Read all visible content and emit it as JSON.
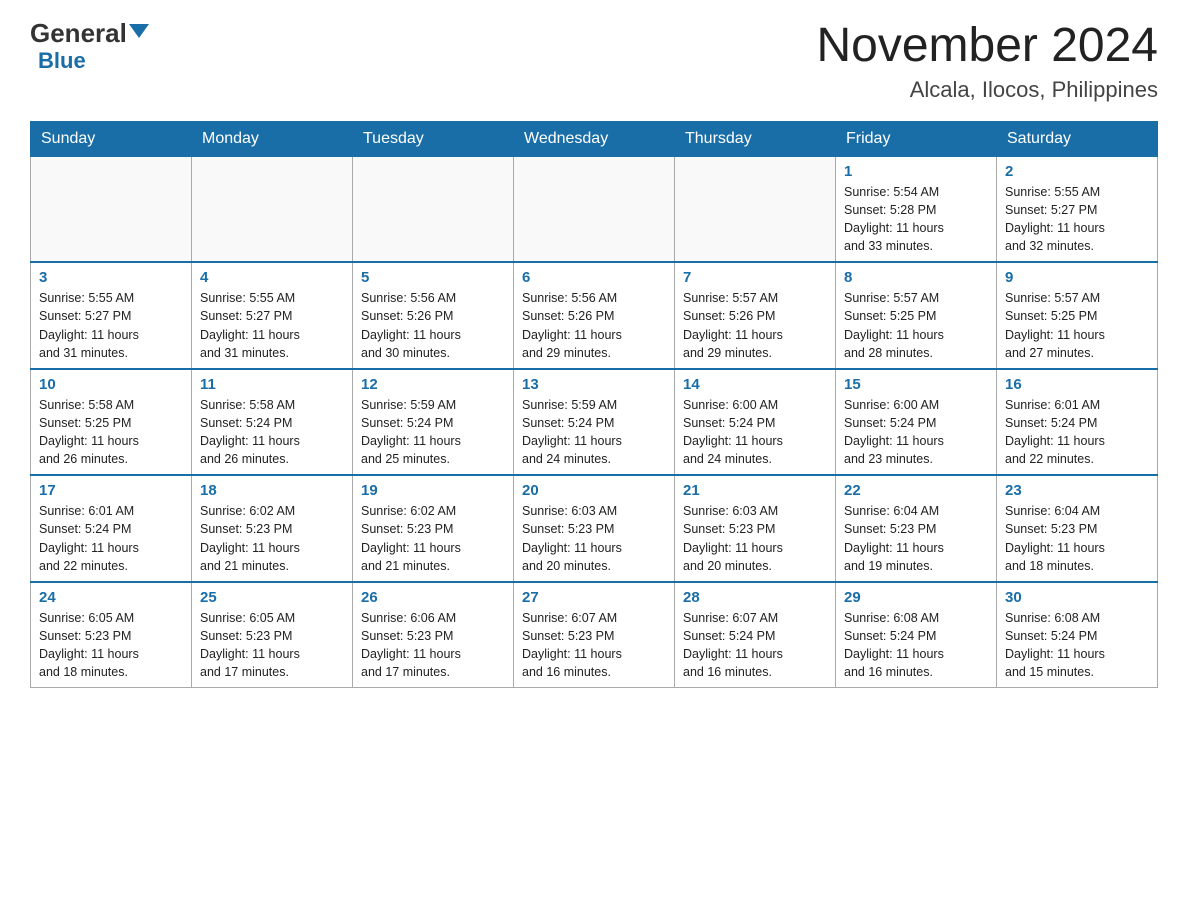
{
  "header": {
    "logo_general": "General",
    "logo_blue": "Blue",
    "month_year": "November 2024",
    "location": "Alcala, Ilocos, Philippines"
  },
  "days_of_week": [
    "Sunday",
    "Monday",
    "Tuesday",
    "Wednesday",
    "Thursday",
    "Friday",
    "Saturday"
  ],
  "weeks": [
    [
      {
        "day": "",
        "info": ""
      },
      {
        "day": "",
        "info": ""
      },
      {
        "day": "",
        "info": ""
      },
      {
        "day": "",
        "info": ""
      },
      {
        "day": "",
        "info": ""
      },
      {
        "day": "1",
        "info": "Sunrise: 5:54 AM\nSunset: 5:28 PM\nDaylight: 11 hours\nand 33 minutes."
      },
      {
        "day": "2",
        "info": "Sunrise: 5:55 AM\nSunset: 5:27 PM\nDaylight: 11 hours\nand 32 minutes."
      }
    ],
    [
      {
        "day": "3",
        "info": "Sunrise: 5:55 AM\nSunset: 5:27 PM\nDaylight: 11 hours\nand 31 minutes."
      },
      {
        "day": "4",
        "info": "Sunrise: 5:55 AM\nSunset: 5:27 PM\nDaylight: 11 hours\nand 31 minutes."
      },
      {
        "day": "5",
        "info": "Sunrise: 5:56 AM\nSunset: 5:26 PM\nDaylight: 11 hours\nand 30 minutes."
      },
      {
        "day": "6",
        "info": "Sunrise: 5:56 AM\nSunset: 5:26 PM\nDaylight: 11 hours\nand 29 minutes."
      },
      {
        "day": "7",
        "info": "Sunrise: 5:57 AM\nSunset: 5:26 PM\nDaylight: 11 hours\nand 29 minutes."
      },
      {
        "day": "8",
        "info": "Sunrise: 5:57 AM\nSunset: 5:25 PM\nDaylight: 11 hours\nand 28 minutes."
      },
      {
        "day": "9",
        "info": "Sunrise: 5:57 AM\nSunset: 5:25 PM\nDaylight: 11 hours\nand 27 minutes."
      }
    ],
    [
      {
        "day": "10",
        "info": "Sunrise: 5:58 AM\nSunset: 5:25 PM\nDaylight: 11 hours\nand 26 minutes."
      },
      {
        "day": "11",
        "info": "Sunrise: 5:58 AM\nSunset: 5:24 PM\nDaylight: 11 hours\nand 26 minutes."
      },
      {
        "day": "12",
        "info": "Sunrise: 5:59 AM\nSunset: 5:24 PM\nDaylight: 11 hours\nand 25 minutes."
      },
      {
        "day": "13",
        "info": "Sunrise: 5:59 AM\nSunset: 5:24 PM\nDaylight: 11 hours\nand 24 minutes."
      },
      {
        "day": "14",
        "info": "Sunrise: 6:00 AM\nSunset: 5:24 PM\nDaylight: 11 hours\nand 24 minutes."
      },
      {
        "day": "15",
        "info": "Sunrise: 6:00 AM\nSunset: 5:24 PM\nDaylight: 11 hours\nand 23 minutes."
      },
      {
        "day": "16",
        "info": "Sunrise: 6:01 AM\nSunset: 5:24 PM\nDaylight: 11 hours\nand 22 minutes."
      }
    ],
    [
      {
        "day": "17",
        "info": "Sunrise: 6:01 AM\nSunset: 5:24 PM\nDaylight: 11 hours\nand 22 minutes."
      },
      {
        "day": "18",
        "info": "Sunrise: 6:02 AM\nSunset: 5:23 PM\nDaylight: 11 hours\nand 21 minutes."
      },
      {
        "day": "19",
        "info": "Sunrise: 6:02 AM\nSunset: 5:23 PM\nDaylight: 11 hours\nand 21 minutes."
      },
      {
        "day": "20",
        "info": "Sunrise: 6:03 AM\nSunset: 5:23 PM\nDaylight: 11 hours\nand 20 minutes."
      },
      {
        "day": "21",
        "info": "Sunrise: 6:03 AM\nSunset: 5:23 PM\nDaylight: 11 hours\nand 20 minutes."
      },
      {
        "day": "22",
        "info": "Sunrise: 6:04 AM\nSunset: 5:23 PM\nDaylight: 11 hours\nand 19 minutes."
      },
      {
        "day": "23",
        "info": "Sunrise: 6:04 AM\nSunset: 5:23 PM\nDaylight: 11 hours\nand 18 minutes."
      }
    ],
    [
      {
        "day": "24",
        "info": "Sunrise: 6:05 AM\nSunset: 5:23 PM\nDaylight: 11 hours\nand 18 minutes."
      },
      {
        "day": "25",
        "info": "Sunrise: 6:05 AM\nSunset: 5:23 PM\nDaylight: 11 hours\nand 17 minutes."
      },
      {
        "day": "26",
        "info": "Sunrise: 6:06 AM\nSunset: 5:23 PM\nDaylight: 11 hours\nand 17 minutes."
      },
      {
        "day": "27",
        "info": "Sunrise: 6:07 AM\nSunset: 5:23 PM\nDaylight: 11 hours\nand 16 minutes."
      },
      {
        "day": "28",
        "info": "Sunrise: 6:07 AM\nSunset: 5:24 PM\nDaylight: 11 hours\nand 16 minutes."
      },
      {
        "day": "29",
        "info": "Sunrise: 6:08 AM\nSunset: 5:24 PM\nDaylight: 11 hours\nand 16 minutes."
      },
      {
        "day": "30",
        "info": "Sunrise: 6:08 AM\nSunset: 5:24 PM\nDaylight: 11 hours\nand 15 minutes."
      }
    ]
  ]
}
